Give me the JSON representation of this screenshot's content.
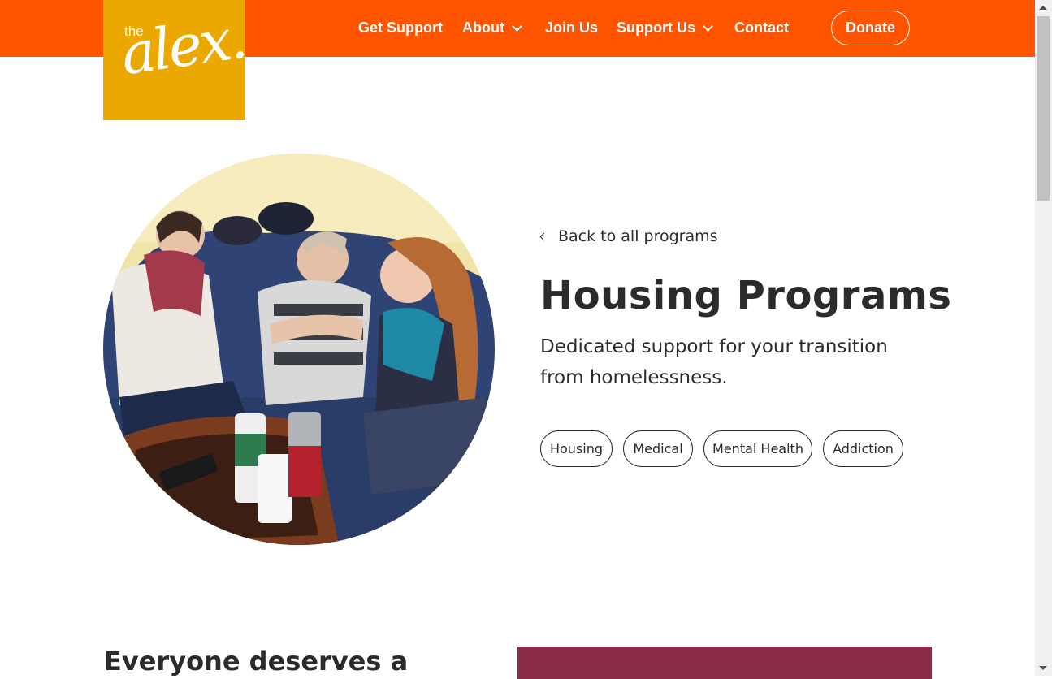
{
  "header": {
    "logo_small": "the",
    "logo_main": "alex.",
    "nav": [
      {
        "label": "Get Support",
        "has_dropdown": false
      },
      {
        "label": "About",
        "has_dropdown": true
      },
      {
        "label": "Join Us",
        "has_dropdown": false
      },
      {
        "label": "Support Us",
        "has_dropdown": true
      },
      {
        "label": "Contact",
        "has_dropdown": false
      }
    ],
    "donate_label": "Donate"
  },
  "program": {
    "back_link": "Back to all programs",
    "title": "Housing Programs",
    "subtitle": "Dedicated support for your transition from homelessness.",
    "tags": [
      "Housing",
      "Medical",
      "Mental Health",
      "Addiction"
    ]
  },
  "section": {
    "heading": "Everyone deserves a"
  },
  "colors": {
    "header_bg": "#ff5500",
    "logo_bg": "#eba800",
    "text": "#2b2b2b",
    "block": "#8b2a44"
  }
}
